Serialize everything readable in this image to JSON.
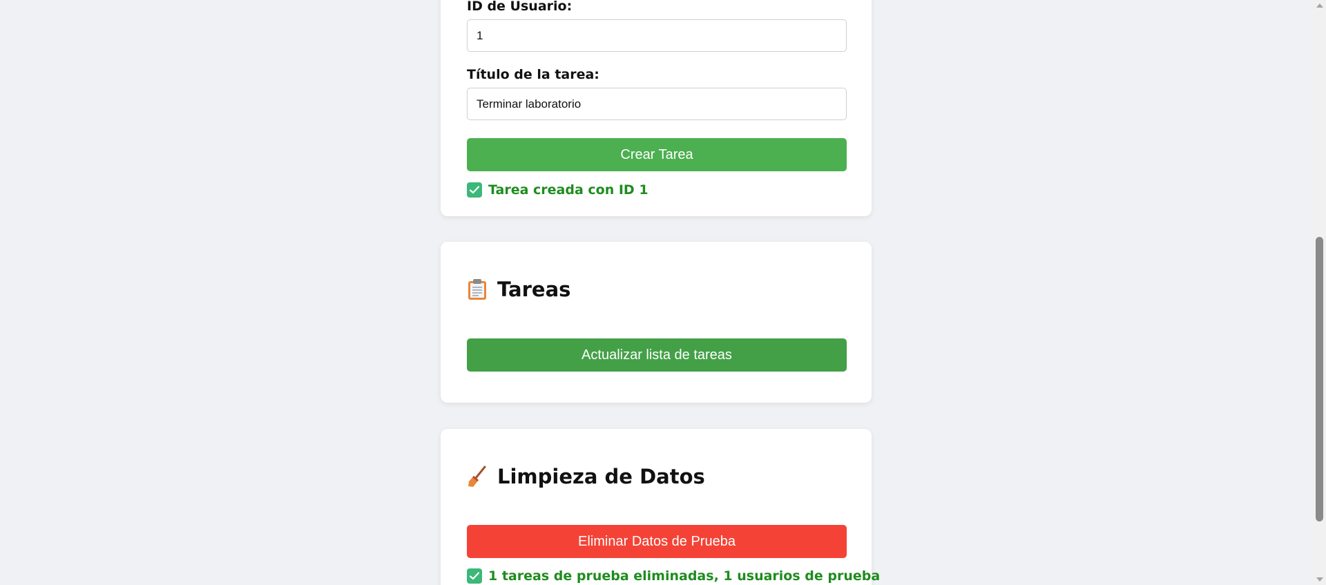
{
  "create_task_form": {
    "user_id_label": "ID de Usuario:",
    "user_id_value": "1",
    "task_title_label": "Título de la tarea:",
    "task_title_value": "Terminar laboratorio",
    "submit_label": "Crear Tarea",
    "status_message": "Tarea creada con ID 1"
  },
  "tasks_section": {
    "title": "Tareas",
    "icon": "clipboard-icon",
    "refresh_label": "Actualizar lista de tareas"
  },
  "cleanup_section": {
    "title": "Limpieza de Datos",
    "icon": "broom-icon",
    "delete_label": "Eliminar Datos de Prueba",
    "status_message": "1 tareas de prueba eliminadas, 1 usuarios de prueba"
  },
  "colors": {
    "background": "#f0f1f5",
    "primary_button": "#4caf50",
    "secondary_button": "#43a047",
    "danger_button": "#f44336",
    "success_text": "#1e8c1e",
    "check_icon": "#3cb878"
  }
}
